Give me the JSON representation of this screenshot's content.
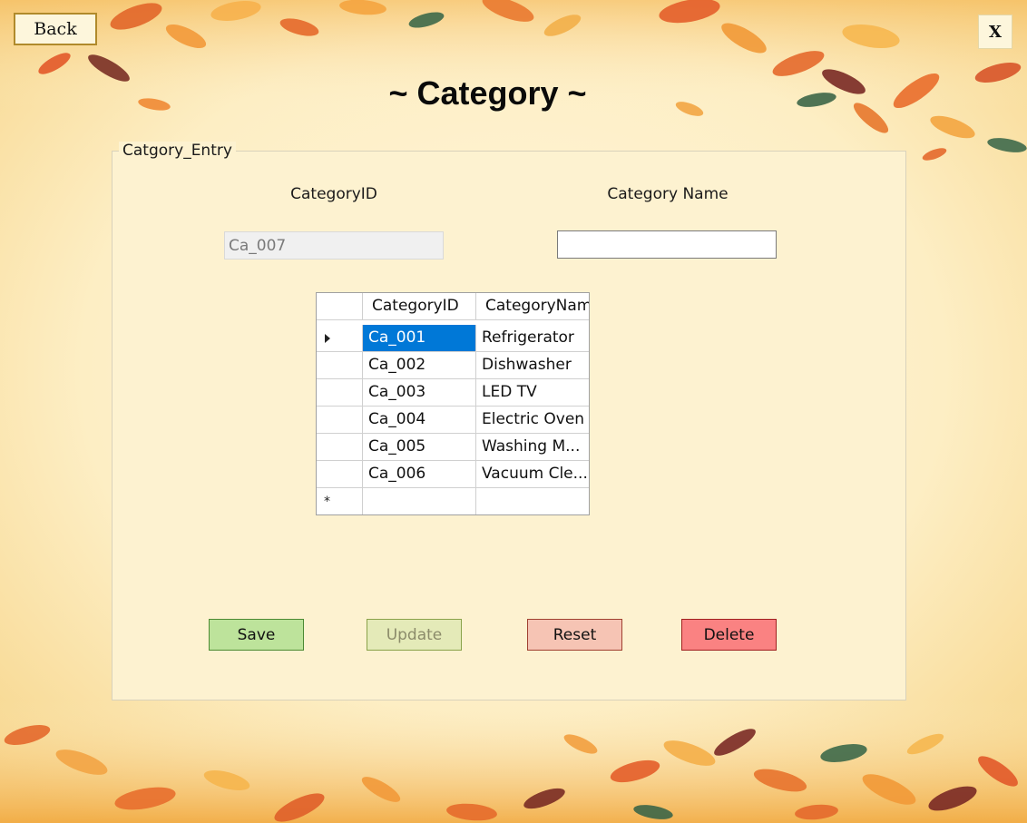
{
  "window": {
    "back_label": "Back",
    "close_label": "X",
    "title": "~ Category ~"
  },
  "form": {
    "group_label": "Catgory_Entry",
    "category_id_label": "CategoryID",
    "category_name_label": "Category Name",
    "category_id_value": "Ca_007",
    "category_name_value": ""
  },
  "grid": {
    "columns": [
      "CategoryID",
      "CategoryNam"
    ],
    "rows": [
      {
        "id": "Ca_001",
        "name": "Refrigerator"
      },
      {
        "id": "Ca_002",
        "name": "Dishwasher"
      },
      {
        "id": "Ca_003",
        "name": "LED TV"
      },
      {
        "id": "Ca_004",
        "name": "Electric Oven"
      },
      {
        "id": "Ca_005",
        "name": "Washing M..."
      },
      {
        "id": "Ca_006",
        "name": "Vacuum Cle..."
      }
    ],
    "new_row_marker": "*"
  },
  "buttons": {
    "save": "Save",
    "update": "Update",
    "reset": "Reset",
    "delete": "Delete"
  },
  "colors": {
    "selection": "#0078d7",
    "save": "#bde39b",
    "update": "#e4eab8",
    "reset": "#f6c4b4",
    "delete": "#fa8282"
  }
}
